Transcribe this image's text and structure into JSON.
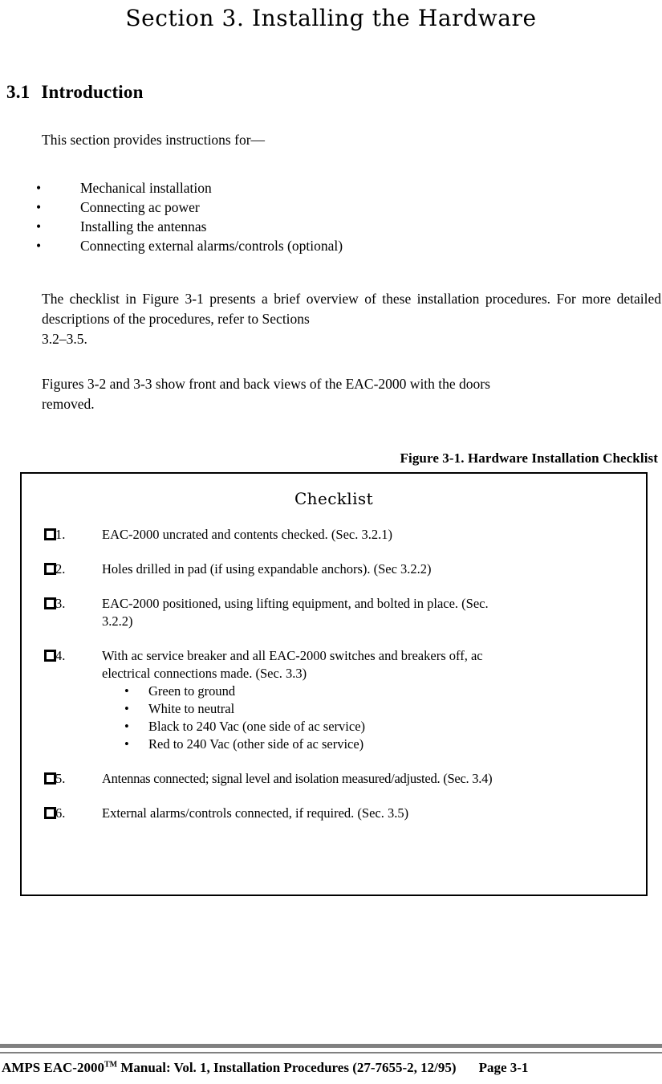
{
  "document": {
    "title": "Section 3.  Installing the Hardware",
    "section": {
      "number": "3.1",
      "heading": "Introduction"
    },
    "intro_paragraph": "This section provides instructions for—",
    "intro_bullets": [
      {
        "marker": "•",
        "text": "Mechanical installation"
      },
      {
        "marker": "•",
        "text": "Connecting ac power"
      },
      {
        "marker": "•",
        "text": "Installing the antennas"
      },
      {
        "marker": "•",
        "text": "Connecting external alarms/controls (optional)"
      }
    ],
    "paragraph_checklist": {
      "line1": "The checklist in Figure 3-1 presents a brief overview of these installation procedures.  For more detailed descriptions of the procedures, refer to Sections",
      "line2": "3.2–3.5."
    },
    "paragraph_figures": {
      "line1": "Figures 3-2 and 3-3 show front and back views of the EAC-2000 with the doors",
      "line2": "removed."
    },
    "figure_caption": "Figure 3-1.  Hardware Installation Checklist"
  },
  "checklist": {
    "title": "Checklist",
    "checkbox_glyph": "empty-square",
    "items": [
      {
        "number": "1.",
        "text": "EAC-2000 uncrated and contents checked.  (Sec. 3.2.1)",
        "wrap": ""
      },
      {
        "number": "2.",
        "text": "Holes drilled in pad (if using expandable anchors).  (Sec 3.2.2)",
        "wrap": ""
      },
      {
        "number": "3.",
        "text": "EAC-2000 positioned, using lifting equipment, and bolted in place.  (Sec.",
        "wrap": "3.2.2)"
      },
      {
        "number": "4.",
        "text": "With ac service breaker and all EAC-2000 switches and breakers off, ac",
        "wrap": "electrical connections made.  (Sec. 3.3)",
        "sub_bullets": [
          {
            "marker": "•",
            "text": "Green to ground"
          },
          {
            "marker": "•",
            "text": "White to neutral"
          },
          {
            "marker": "•",
            "text": "Black to 240 Vac (one side of ac service)"
          },
          {
            "marker": "•",
            "text": "Red to 240 Vac (other side of ac service)"
          }
        ]
      },
      {
        "number": "5.",
        "text": "Antennas connected; signal level and isolation measured/adjusted.  (Sec. 3.4)",
        "wrap": ""
      },
      {
        "number": "6.",
        "text": "External alarms/controls connected, if required.  (Sec. 3.5)",
        "wrap": ""
      }
    ]
  },
  "footer": {
    "main_before_tm": "AMPS EAC-2000",
    "trademark": "TM",
    "main_after_tm": " Manual:  Vol. 1, Installation Procedures (27-7655-2, 12/95)",
    "page": "Page 3-1",
    "rule_color": "#808080"
  }
}
